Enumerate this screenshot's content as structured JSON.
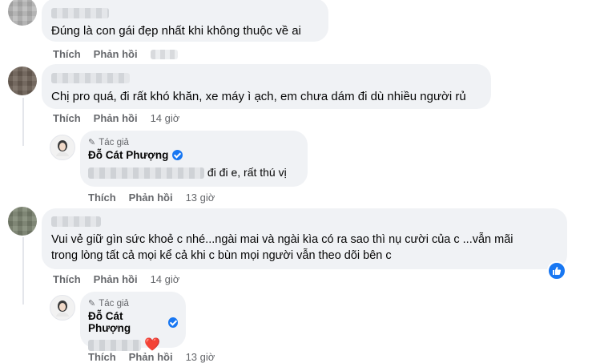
{
  "comments": [
    {
      "text": "Đúng là con gái đẹp nhất khi không thuộc về ai",
      "like_label": "Thích",
      "reply_label": "Phản hồi"
    },
    {
      "text": "Chị pro quá, đi rất khó khăn, xe máy ì ạch, em chưa dám đi dù nhiều người rủ",
      "like_label": "Thích",
      "reply_label": "Phản hồi",
      "time": "14 giờ",
      "reply": {
        "author_tag": "Tác giả",
        "author_name": "Đỗ Cát Phượng",
        "text": "đi đi e, rất thú vị",
        "like_label": "Thích",
        "reply_label": "Phản hồi",
        "time": "13 giờ"
      }
    },
    {
      "text_line1": "Vui vẻ giữ gìn sức khoẻ c nhé...ngài mai và ngài kìa có ra sao thì nụ cười của c ...vẫn mãi",
      "text_line2": "trong lòng tất cả mọi kể cả khi c bùn mọi người vẫn theo dõi bên c",
      "like_label": "Thích",
      "reply_label": "Phản hồi",
      "time": "14 giờ",
      "reactions": [
        "like-icon"
      ],
      "reply": {
        "author_tag": "Tác giả",
        "author_name": "Đỗ Cát Phượng",
        "emoji": "❤️",
        "like_label": "Thích",
        "reply_label": "Phản hồi",
        "time": "13 giờ"
      }
    }
  ],
  "colors": {
    "bubble": "#f0f2f5",
    "secondary_text": "#65676b",
    "verified": "#1877f2",
    "heart": "#e0245e"
  }
}
